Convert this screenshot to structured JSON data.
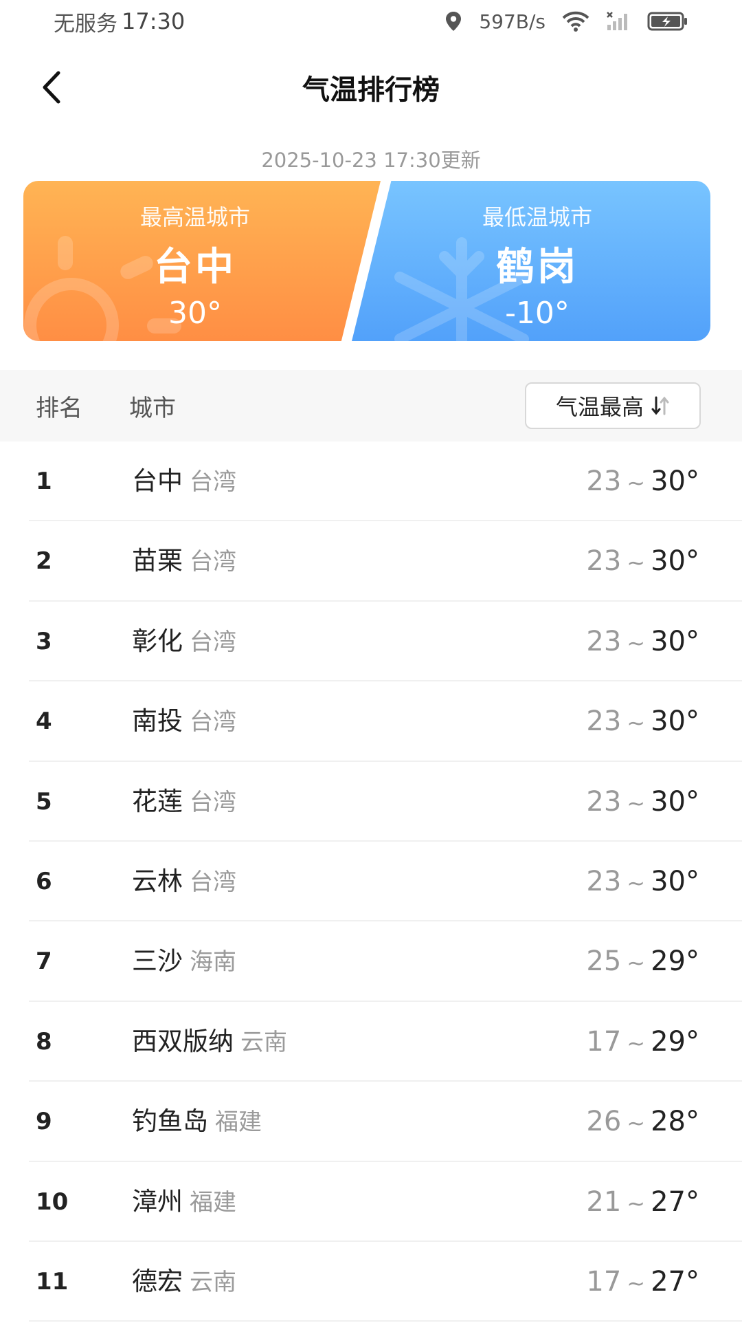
{
  "status_bar": {
    "carrier": "无服务",
    "time": "17:30",
    "net_speed": "597B/s"
  },
  "header": {
    "title": "气温排行榜"
  },
  "update_time": "2025-10-23 17:30更新",
  "highlight": {
    "hot": {
      "label": "最高温城市",
      "city": "台中",
      "temp": "30°"
    },
    "cold": {
      "label": "最低温城市",
      "city": "鹤岗",
      "temp": "-10°"
    }
  },
  "table_header": {
    "rank": "排名",
    "city": "城市",
    "sort_label": "气温最高"
  },
  "rows": [
    {
      "rank": "1",
      "city": "台中",
      "province": "台湾",
      "min": "23",
      "max": "30°"
    },
    {
      "rank": "2",
      "city": "苗栗",
      "province": "台湾",
      "min": "23",
      "max": "30°"
    },
    {
      "rank": "3",
      "city": "彰化",
      "province": "台湾",
      "min": "23",
      "max": "30°"
    },
    {
      "rank": "4",
      "city": "南投",
      "province": "台湾",
      "min": "23",
      "max": "30°"
    },
    {
      "rank": "5",
      "city": "花莲",
      "province": "台湾",
      "min": "23",
      "max": "30°"
    },
    {
      "rank": "6",
      "city": "云林",
      "province": "台湾",
      "min": "23",
      "max": "30°"
    },
    {
      "rank": "7",
      "city": "三沙",
      "province": "海南",
      "min": "25",
      "max": "29°"
    },
    {
      "rank": "8",
      "city": "西双版纳",
      "province": "云南",
      "min": "17",
      "max": "29°"
    },
    {
      "rank": "9",
      "city": "钓鱼岛",
      "province": "福建",
      "min": "26",
      "max": "28°"
    },
    {
      "rank": "10",
      "city": "漳州",
      "province": "福建",
      "min": "21",
      "max": "27°"
    },
    {
      "rank": "11",
      "city": "德宏",
      "province": "云南",
      "min": "17",
      "max": "27°"
    }
  ],
  "tilde": "~",
  "colors": {
    "hot_card": "#ff9d4a",
    "cold_card": "#5ea9fb",
    "header_bg": "#f7f7f7"
  }
}
